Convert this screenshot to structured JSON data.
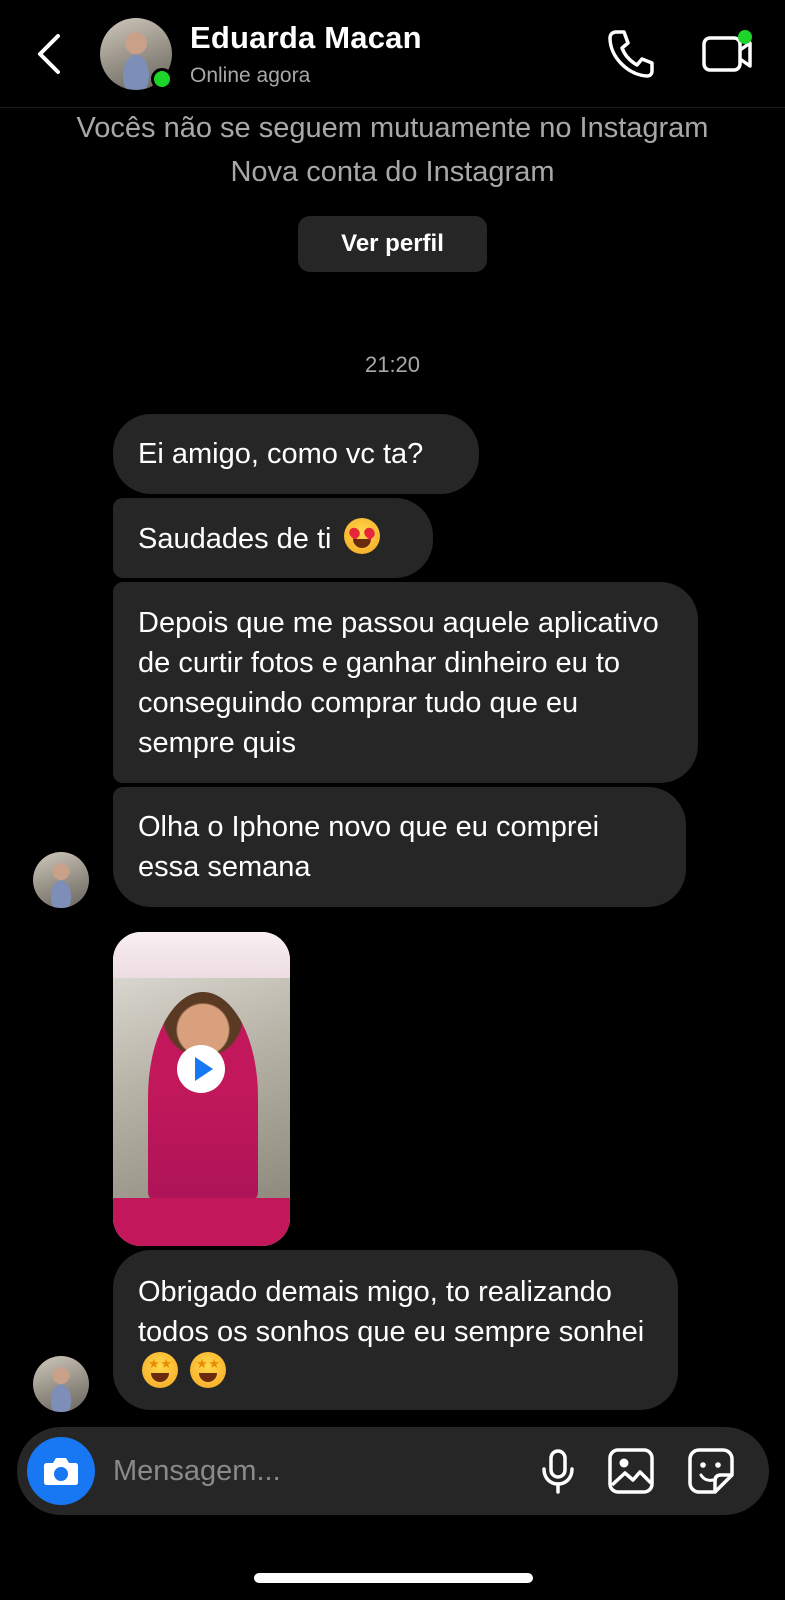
{
  "header": {
    "contact_name": "Eduarda Macan",
    "status": "Online agora"
  },
  "info": {
    "line1": "Vocês não se seguem mutuamente no Instagram",
    "line2": "Nova conta do Instagram",
    "view_profile_label": "Ver perfil"
  },
  "timestamp": "21:20",
  "messages": [
    "Ei amigo, como vc ta?",
    "Saudades de ti",
    "Depois que me passou aquele aplicativo de curtir fotos e ganhar dinheiro eu to conseguindo comprar tudo que eu sempre quis",
    "Olha o Iphone novo que eu comprei essa semana",
    "Obrigado demais migo, to realizando todos os sonhos que eu sempre sonhei"
  ],
  "composer": {
    "placeholder": "Mensagem..."
  },
  "colors": {
    "background": "#000000",
    "bubble": "#262626",
    "online": "#1ed42a",
    "camera_button": "#1877f2"
  },
  "icons": [
    "back-arrow-icon",
    "phone-icon",
    "video-call-icon",
    "camera-icon",
    "microphone-icon",
    "gallery-icon",
    "sticker-icon",
    "play-icon"
  ]
}
